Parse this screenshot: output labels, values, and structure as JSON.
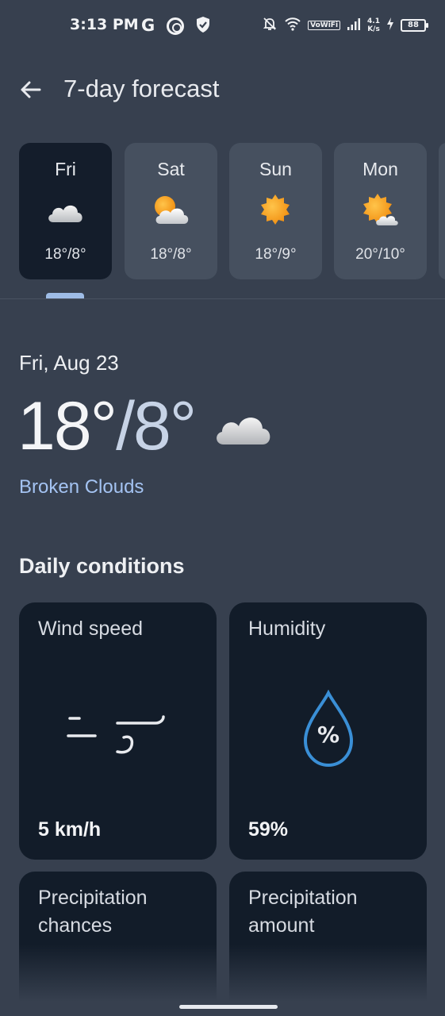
{
  "status_bar": {
    "time": "3:13 PM",
    "left_icons": [
      "google-icon",
      "data-saver-icon",
      "shield-icon"
    ],
    "volte": "VoWiFi",
    "net_speed_value": "4.1",
    "net_speed_unit": "K/s",
    "battery": "88"
  },
  "header": {
    "title": "7-day forecast",
    "back_icon": "arrow-left-icon"
  },
  "days": [
    {
      "name": "Fri",
      "temp": "18°/8°",
      "icon": "cloud-icon",
      "selected": true
    },
    {
      "name": "Sat",
      "temp": "18°/8°",
      "icon": "partly-cloudy-icon",
      "selected": false
    },
    {
      "name": "Sun",
      "temp": "18°/9°",
      "icon": "sun-icon",
      "selected": false
    },
    {
      "name": "Mon",
      "temp": "20°/10°",
      "icon": "partly-cloudy-icon",
      "selected": false
    }
  ],
  "summary": {
    "date": "Fri, Aug 23",
    "high": "18°",
    "separator": "/",
    "low": "8°",
    "condition": "Broken Clouds",
    "icon": "cloud-icon"
  },
  "daily_conditions": {
    "title": "Daily conditions",
    "cards": [
      {
        "label": "Wind speed",
        "value": "5 km/h",
        "icon": "wind-icon"
      },
      {
        "label": "Humidity",
        "value": "59%",
        "icon": "humidity-drop-icon",
        "icon_text": "%"
      },
      {
        "label": "Precipitation chances",
        "value": "",
        "icon": "umbrella-icon"
      },
      {
        "label": "Precipitation amount",
        "value": "",
        "icon": "rain-gauge-icon"
      }
    ]
  },
  "colors": {
    "background": "#37404f",
    "card": "#46505f",
    "card_selected": "#141d2b",
    "condition_card": "#121c29",
    "accent": "#a4c3f2",
    "humidity_blue": "#3a8fd6"
  }
}
